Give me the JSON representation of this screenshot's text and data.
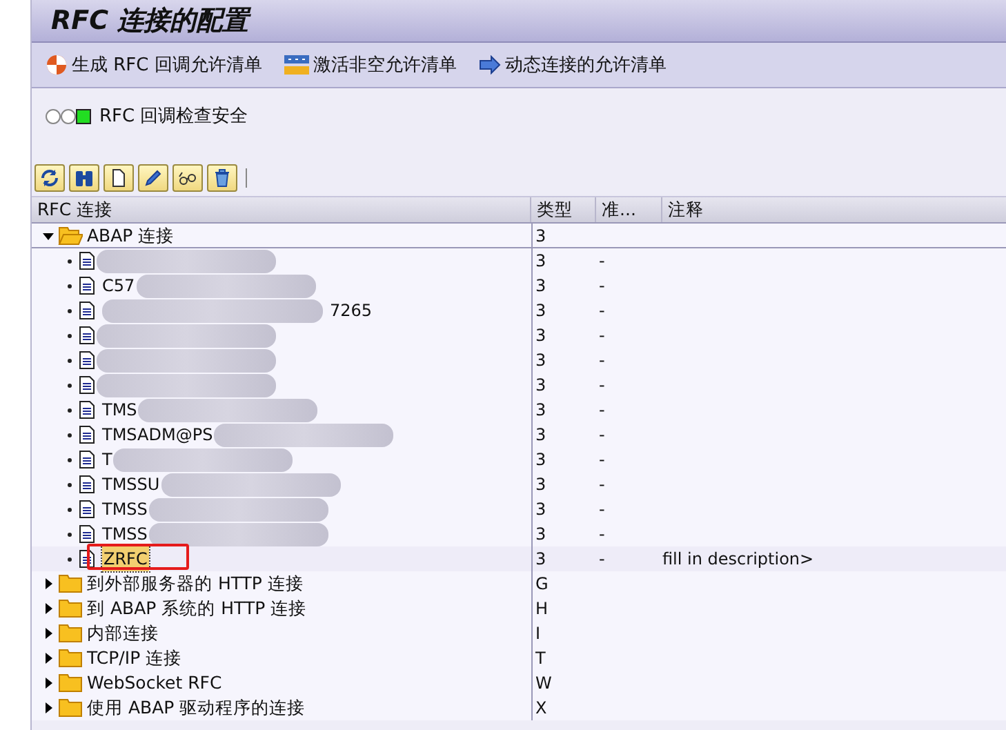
{
  "window": {
    "title": "RFC 连接的配置"
  },
  "toolbar": [
    {
      "kind": "target",
      "label": "生成 RFC 回调允许清单"
    },
    {
      "kind": "grid",
      "label": "激活非空允许清单"
    },
    {
      "kind": "arrow",
      "label": "动态连接的允许清单"
    }
  ],
  "status": {
    "label": "RFC 回调检查安全"
  },
  "actions": [
    {
      "kind": "refresh"
    },
    {
      "kind": "find"
    },
    {
      "kind": "new"
    },
    {
      "kind": "edit"
    },
    {
      "kind": "display"
    },
    {
      "kind": "delete"
    }
  ],
  "table": {
    "columns": [
      "RFC 连接",
      "类型",
      "准...",
      "注释"
    ],
    "rows": [
      {
        "name": "ABAP 连接",
        "type": "3",
        "expanded": true,
        "children": [
          {
            "blurred": true,
            "type": "3",
            "col3": "-",
            "selected": false
          },
          {
            "name": "C57",
            "blurred": true,
            "type": "3",
            "col3": "-",
            "selected": false
          },
          {
            "name": "7265",
            "blurred": true,
            "type": "3",
            "col3": "-",
            "tail": true,
            "selected": false
          },
          {
            "blurred": true,
            "type": "3",
            "col3": "-",
            "selected": false
          },
          {
            "blurred": true,
            "type": "3",
            "col3": "-",
            "selected": false
          },
          {
            "blurred": true,
            "type": "3",
            "col3": "-",
            "selected": false
          },
          {
            "name": "TMS",
            "blurred": true,
            "type": "3",
            "col3": "-",
            "selected": false
          },
          {
            "name": "TMSADM@PS",
            "blurred": true,
            "type": "3",
            "col3": "-",
            "selected": false
          },
          {
            "name": "T",
            "blurred": true,
            "type": "3",
            "col3": "-",
            "selected": false
          },
          {
            "name": "TMSSU",
            "blurred": true,
            "type": "3",
            "col3": "-",
            "selected": false
          },
          {
            "name": "TMSS",
            "blurred": true,
            "type": "3",
            "col3": "-",
            "selected": false
          },
          {
            "name": "TMSS",
            "blurred": true,
            "type": "3",
            "col3": "-",
            "selected": false
          },
          {
            "name": "ZRFC",
            "type": "3",
            "col3": "-",
            "note": "fill in description>",
            "selected": true,
            "annotated": true
          }
        ]
      },
      {
        "name": "到外部服务器的 HTTP 连接",
        "type": "G",
        "expanded": false
      },
      {
        "name": "到 ABAP 系统的 HTTP 连接",
        "type": "H",
        "expanded": false
      },
      {
        "name": "内部连接",
        "type": "I",
        "expanded": false
      },
      {
        "name": "TCP/IP 连接",
        "type": "T",
        "expanded": false
      },
      {
        "name": "WebSocket RFC",
        "type": "W",
        "expanded": false
      },
      {
        "name": "使用 ABAP 驱动程序的连接",
        "type": "X",
        "expanded": false
      }
    ]
  }
}
